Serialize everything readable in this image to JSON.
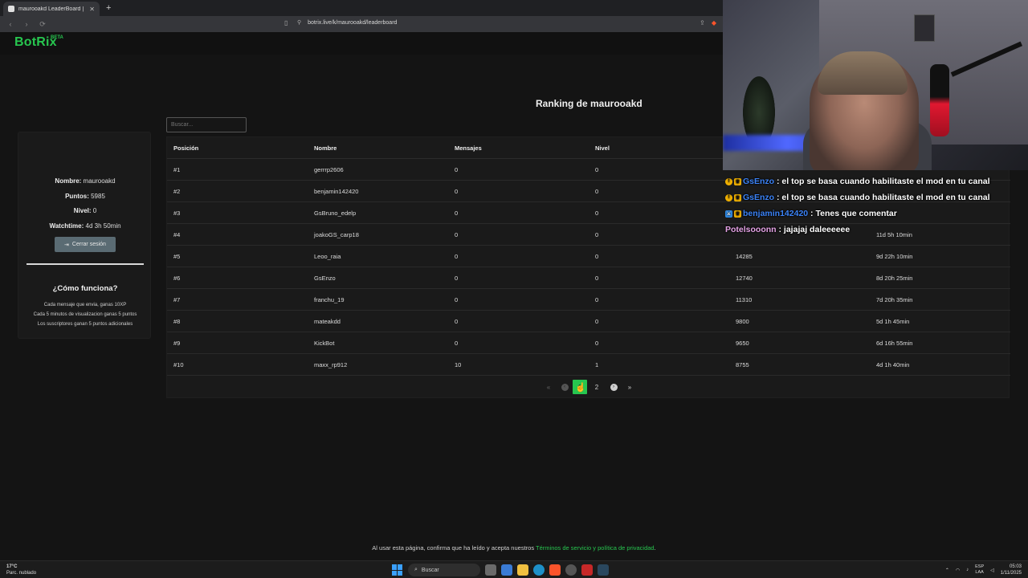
{
  "browser": {
    "tab_title": "maurooakd LeaderBoard | The b",
    "tab_close": "✕",
    "new_tab": "+",
    "url": "botrix.live/k/maurooakd/leaderboard"
  },
  "brand": {
    "logo": "BotRix",
    "beta": "BETA"
  },
  "ranking_title": "Ranking de maurooakd",
  "search": {
    "placeholder": "Buscar..."
  },
  "profile": {
    "name_label": "Nombre:",
    "name": "maurooakd",
    "points_label": "Puntos:",
    "points": "5985",
    "level_label": "Nivel:",
    "level": "0",
    "watchtime_label": "Watchtime:",
    "watchtime": "4d 3h 50min",
    "logout": "Cerrar sesión"
  },
  "how": {
    "title": "¿Cómo funciona?",
    "lines": [
      "Cada mensaje que envia, ganas 10XP",
      "Cada 5 minutos de visualizacion ganas 5 puntos",
      "Los suscriptores ganan 5 puntos adicionales"
    ]
  },
  "table": {
    "headers": [
      "Posición",
      "Nombre",
      "Mensajes",
      "Nivel",
      "",
      ""
    ],
    "rows": [
      [
        "#1",
        "gerrrp2606",
        "0",
        "0",
        "",
        ""
      ],
      [
        "#2",
        "benjamin142420",
        "0",
        "0",
        "",
        ""
      ],
      [
        "#3",
        "GsBruno_edelp",
        "0",
        "0",
        "",
        ""
      ],
      [
        "#4",
        "joakoGS_carp18",
        "0",
        "0",
        "",
        "11d 5h 10min"
      ],
      [
        "#5",
        "Leoo_raia",
        "0",
        "0",
        "14285",
        "9d 22h 10min"
      ],
      [
        "#6",
        "GsEnzo",
        "0",
        "0",
        "12740",
        "8d 20h 25min"
      ],
      [
        "#7",
        "franchu_19",
        "0",
        "0",
        "11310",
        "7d 20h 35min"
      ],
      [
        "#8",
        "mateakdd",
        "0",
        "0",
        "9800",
        "5d 1h 45min"
      ],
      [
        "#9",
        "KickBot",
        "0",
        "0",
        "9650",
        "6d 16h 55min"
      ],
      [
        "#10",
        "maxx_rp912",
        "10",
        "1",
        "8755",
        "4d 1h 40min"
      ]
    ]
  },
  "pagination": {
    "first": "«",
    "prev": "‹",
    "current": "1",
    "next_page": "2",
    "next": "›",
    "last": "»"
  },
  "footer": {
    "text": "Al usar esta página, confirma que ha leído y acepta nuestros ",
    "link": "Términos de servicio y política de privacidad",
    "end": "."
  },
  "chat": [
    {
      "badges": [
        "warn",
        "crown"
      ],
      "user": "GsEnzo",
      "user_color": "#3b82f6",
      "message": " : el top se basa cuando habilitaste el mod en tu canal"
    },
    {
      "badges": [
        "warn",
        "crown"
      ],
      "user": "GsEnzo",
      "user_color": "#3b82f6",
      "message": " : el top se basa cuando habilitaste el mod en tu canal"
    },
    {
      "badges": [
        "mod",
        "crown"
      ],
      "user": "benjamin142420",
      "user_color": "#3b82f6",
      "message": " : Tenes que comentar"
    },
    {
      "badges": [],
      "user": "Potelsooonn",
      "user_color": "#e5a3e6",
      "message": " : jajajaj daleeeeee"
    }
  ],
  "taskbar": {
    "temp": "17°C",
    "weather": "Parc. nublado",
    "search": "Buscar",
    "lang_top": "ESP",
    "lang_bottom": "LAA",
    "time": "05:03",
    "date": "1/11/2025"
  },
  "colors": {
    "accent": "#27c64f",
    "background": "#141414",
    "panel": "#1a1a1a"
  }
}
